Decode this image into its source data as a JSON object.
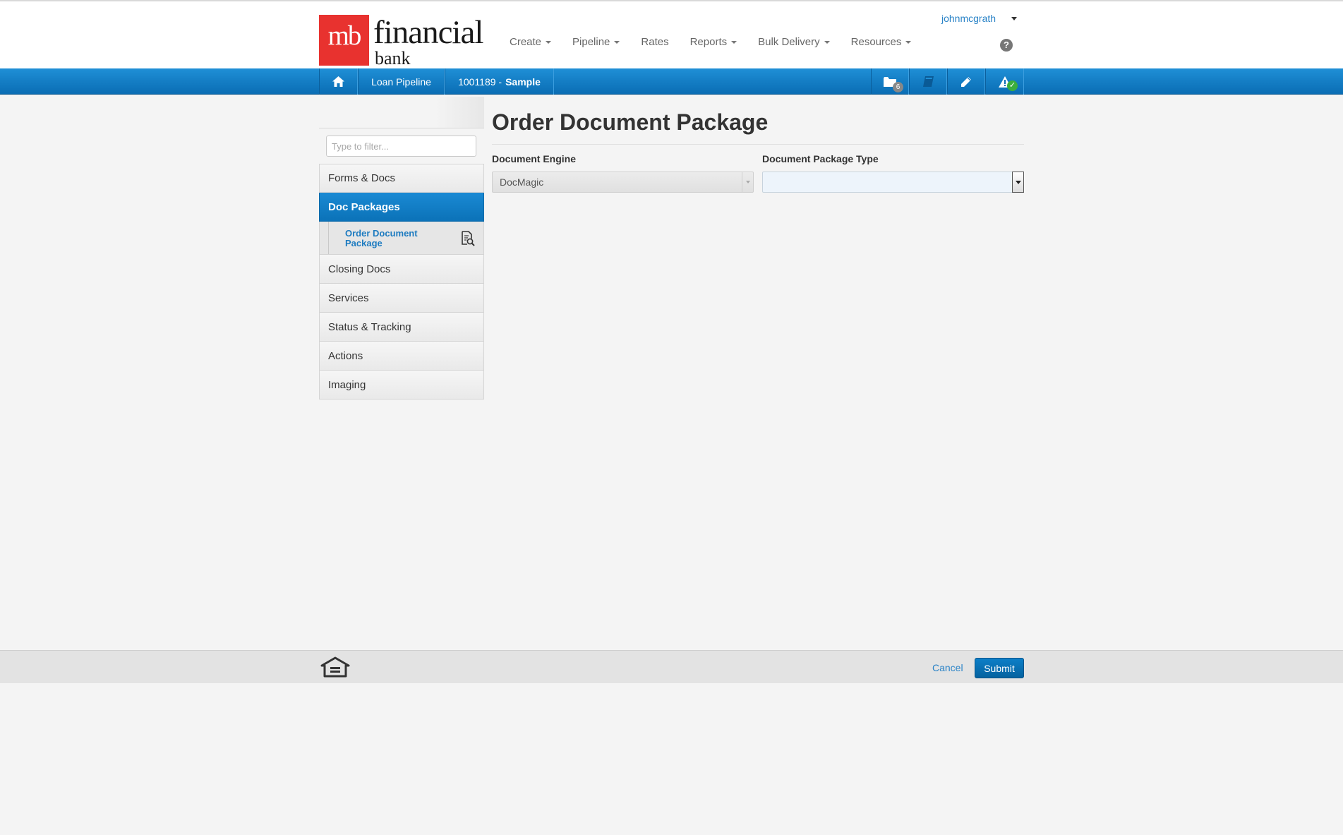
{
  "brand": {
    "mark": "mb",
    "word1": "financial",
    "word2": "bank"
  },
  "nav": {
    "items": [
      {
        "label": "Create",
        "dropdown": true
      },
      {
        "label": "Pipeline",
        "dropdown": true
      },
      {
        "label": "Rates",
        "dropdown": false
      },
      {
        "label": "Reports",
        "dropdown": true
      },
      {
        "label": "Bulk Delivery",
        "dropdown": true
      },
      {
        "label": "Resources",
        "dropdown": true
      }
    ],
    "user": "johnmcgrath",
    "help_glyph": "?"
  },
  "breadcrumb": {
    "home_icon": "home-icon",
    "pipeline": "Loan Pipeline",
    "loan_number": "1001189 -",
    "loan_name": "Sample"
  },
  "toolbar": {
    "folder_badge": "6",
    "icons": [
      "folder-icon",
      "book-icon",
      "pencil-icon",
      "alert-check-icon"
    ]
  },
  "sidebar": {
    "filter_placeholder": "Type to filter...",
    "items": [
      {
        "label": "Forms & Docs"
      },
      {
        "label": "Doc Packages",
        "active": true
      },
      {
        "label": "Closing Docs"
      },
      {
        "label": "Services"
      },
      {
        "label": "Status & Tracking"
      },
      {
        "label": "Actions"
      },
      {
        "label": "Imaging"
      }
    ],
    "sub_item": "Order Document Package"
  },
  "main": {
    "title": "Order Document Package",
    "engine_label": "Document Engine",
    "engine_value": "DocMagic",
    "package_label": "Document Package Type",
    "package_value": ""
  },
  "footer": {
    "cancel": "Cancel",
    "submit": "Submit"
  },
  "colors": {
    "accent": "#0b72b8",
    "brand_red": "#e8322f",
    "link": "#2a83c7"
  }
}
